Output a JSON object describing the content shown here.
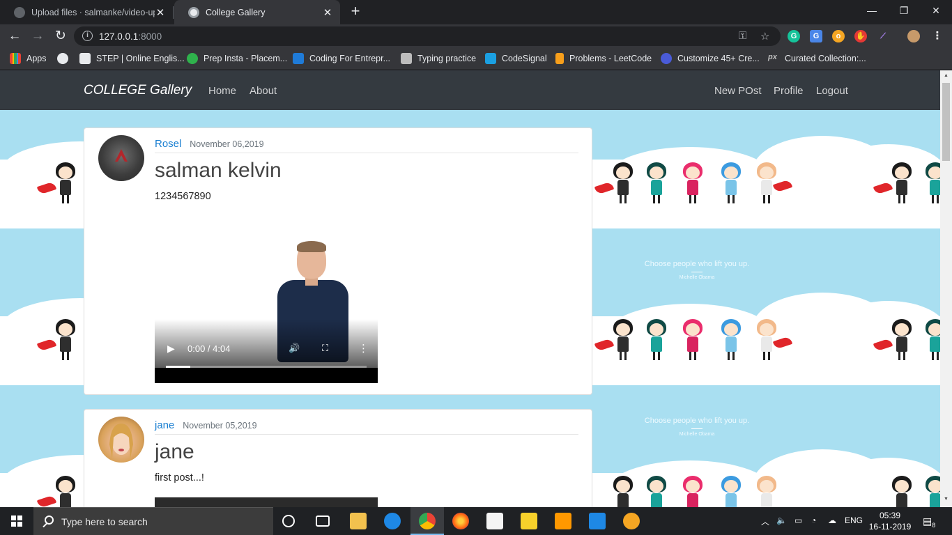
{
  "browser": {
    "tabs": [
      {
        "title": "Upload files · salmanke/video-up"
      },
      {
        "title": "College Gallery"
      }
    ],
    "url_host": "127.0.0.1",
    "url_port": ":8000",
    "bookmarks": [
      {
        "label": "Apps"
      },
      {
        "label": ""
      },
      {
        "label": "STEP | Online Englis..."
      },
      {
        "label": "Prep Insta - Placem..."
      },
      {
        "label": "Coding For Entrepr..."
      },
      {
        "label": "Typing practice"
      },
      {
        "label": "CodeSignal"
      },
      {
        "label": "Problems - LeetCode"
      },
      {
        "label": "Customize 45+ Cre..."
      },
      {
        "label": "Curated Collection:..."
      }
    ]
  },
  "site": {
    "brand": "COLLEGE Gallery",
    "nav_left": [
      "Home",
      "About"
    ],
    "nav_right": [
      "New POst",
      "Profile",
      "Logout"
    ],
    "wallpaper_quote": "Choose people who lift you up.",
    "wallpaper_author": "Michelle Obama"
  },
  "posts": [
    {
      "author": "Rosel",
      "date": "November 06,2019",
      "title": "salman kelvin",
      "body": "1234567890",
      "video_time": "0:00 / 4:04",
      "video_progress": 0.12
    },
    {
      "author": "jane",
      "date": "November 05,2019",
      "title": "jane",
      "body": "first post...!"
    }
  ],
  "taskbar": {
    "search_placeholder": "Type here to search",
    "language": "ENG",
    "time": "05:39",
    "date": "16-11-2019",
    "notification_count": "8"
  }
}
